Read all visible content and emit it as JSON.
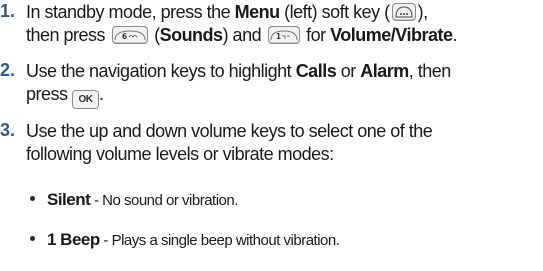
{
  "steps": [
    {
      "number": "1.",
      "line1_a": "In standby mode, press the ",
      "line1_b": "Menu",
      "line1_c": " (left) soft key (",
      "line1_d": "),",
      "line2_a": "then press ",
      "line2_b": " (",
      "line2_c": "Sounds",
      "line2_d": ") and ",
      "line2_e": " for ",
      "line2_f": "Volume/Vibrate",
      "line2_g": "."
    },
    {
      "number": "2.",
      "line1_a": "Use the navigation keys to highlight ",
      "line1_b": "Calls",
      "line1_c": " or ",
      "line1_d": "Alarm",
      "line1_e": ", then",
      "line2_a": "press ",
      "line2_b": ".",
      "ok_key_label": "OK"
    },
    {
      "number": "3.",
      "line1": "Use the up and down volume keys to select one of the",
      "line2": "following volume levels or vibrate modes:"
    }
  ],
  "bullets": [
    {
      "term": "Silent",
      "sep": " - ",
      "desc": "No sound or vibration."
    },
    {
      "term": "1 Beep",
      "sep": " - ",
      "desc": "Plays a single beep without vibration."
    }
  ],
  "icons": {
    "menu_soft_key": "menu-soft-key-icon",
    "key_6": "key-6-mno-icon",
    "key_1": "key-1-icon",
    "ok_key": "ok-key-icon"
  },
  "colors": {
    "number": "#2b5c8a",
    "text": "#1a1a1a"
  }
}
